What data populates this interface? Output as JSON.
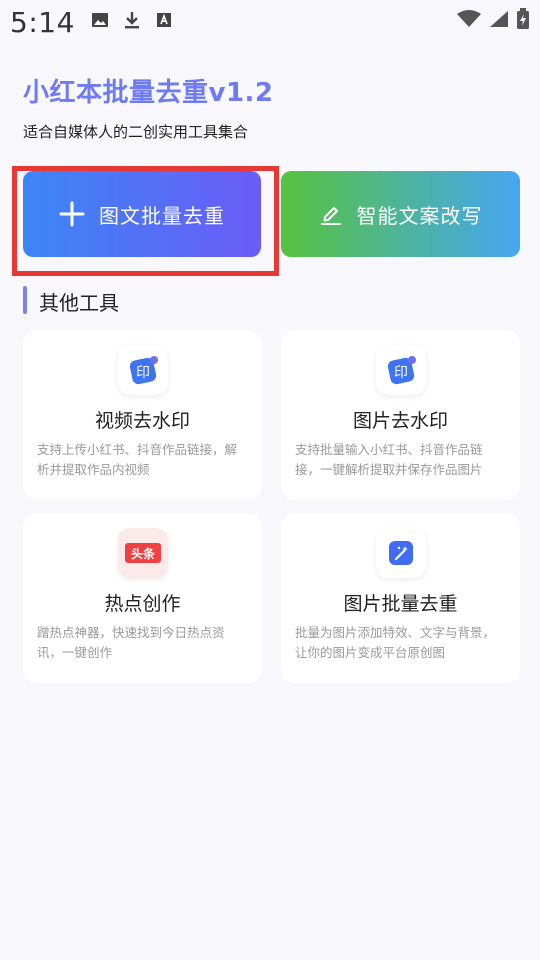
{
  "status_bar": {
    "time": "5:14",
    "left_icons": [
      "image-icon",
      "download-icon",
      "font-icon"
    ],
    "right_icons": [
      "wifi-icon",
      "signal-icon",
      "battery-icon"
    ]
  },
  "header": {
    "title": "小红本批量去重v1.2",
    "subtitle": "适合自媒体人的二创实用工具集合"
  },
  "actions": {
    "dedupe_label": "图文批量去重",
    "rewrite_label": "智能文案改写"
  },
  "section": {
    "title": "其他工具"
  },
  "tools": [
    {
      "title": "视频去水印",
      "desc": "支持上传小红书、抖音作品链接，解析并提取作品内视频",
      "icon": "印"
    },
    {
      "title": "图片去水印",
      "desc": "支持批量输入小红书、抖音作品链接，一键解析提取并保存作品图片",
      "icon": "印"
    },
    {
      "title": "热点创作",
      "desc": "蹭热点神器，快速找到今日热点资讯，一键创作",
      "icon": "头条"
    },
    {
      "title": "图片批量去重",
      "desc": "批量为图片添加特效、文字与背景，让你的图片变成平台原创图",
      "icon": "magic-wand-icon"
    }
  ],
  "colors": {
    "title": "#6e7bf2",
    "dedupe_gradient": [
      "#3c86f6",
      "#6a5cf7"
    ],
    "rewrite_gradient": [
      "#56c23f",
      "#47a6f3"
    ],
    "highlight": "#e53935"
  }
}
